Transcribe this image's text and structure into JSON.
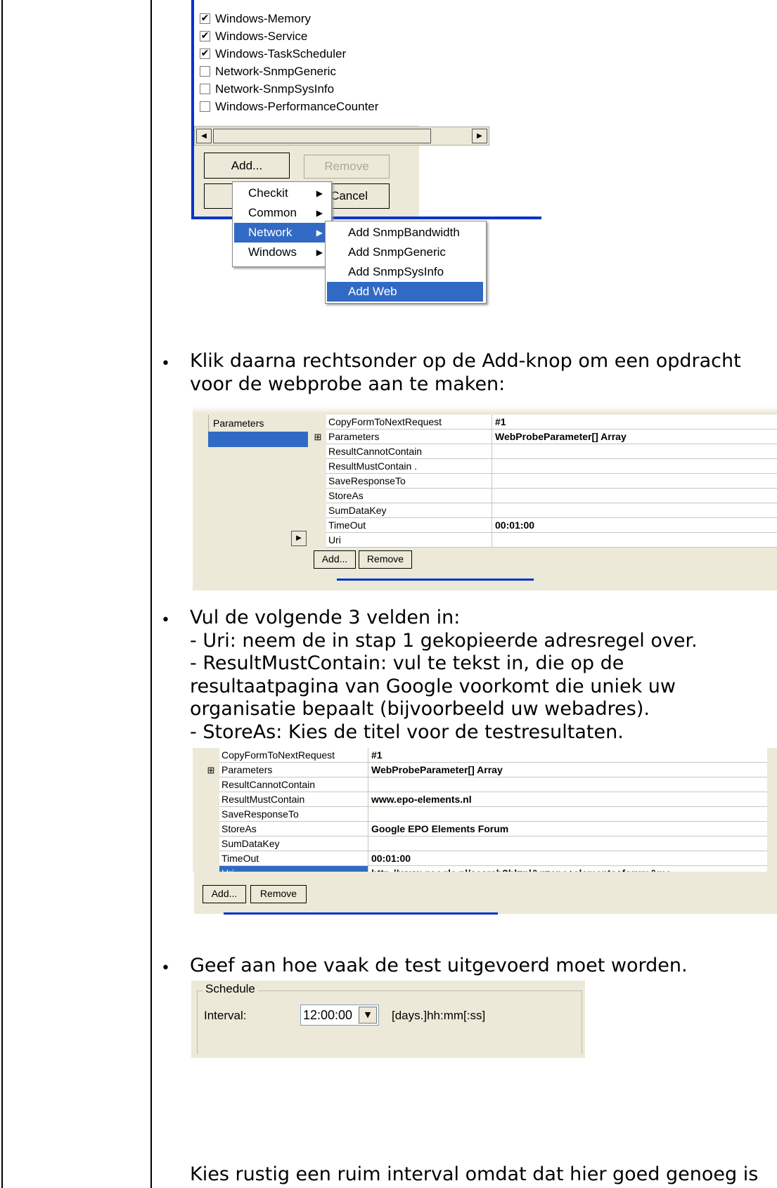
{
  "colors": {
    "selected": "#316ac5",
    "window_bg": "#ece9d8",
    "accent_blue": "#0033cc"
  },
  "checklist": {
    "items": [
      {
        "label": "Windows-Memory",
        "checked": true
      },
      {
        "label": "Windows-Service",
        "checked": true
      },
      {
        "label": "Windows-TaskScheduler",
        "checked": true
      },
      {
        "label": "Network-SnmpGeneric",
        "checked": false
      },
      {
        "label": "Network-SnmpSysInfo",
        "checked": false
      },
      {
        "label": "Windows-PerformanceCounter",
        "checked": false
      }
    ],
    "add_label": "Add...",
    "remove_label": "Remove",
    "cancel_label": "Cancel"
  },
  "context_menu": {
    "items": [
      "Checkit",
      "Common",
      "Network",
      "Windows"
    ],
    "selected": "Network",
    "submenu": [
      "Add SnmpBandwidth",
      "Add SnmpGeneric",
      "Add SnmpSysInfo",
      "Add Web"
    ],
    "submenu_selected": "Add Web"
  },
  "step1": {
    "bullet": "•",
    "line1": "Klik daarna rechtsonder op de Add-knop om een opdracht",
    "line2": "voor de webprobe aan te maken:"
  },
  "grid1": {
    "left_header": "Parameters",
    "rows": [
      {
        "name": "CopyFormToNextRequest",
        "value": "#1"
      },
      {
        "name": "Parameters",
        "value": "WebProbeParameter[] Array",
        "expand": "⊞"
      },
      {
        "name": "ResultCannotContain",
        "value": ""
      },
      {
        "name": "ResultMustContain  .",
        "value": ""
      },
      {
        "name": "SaveResponseTo",
        "value": ""
      },
      {
        "name": "StoreAs",
        "value": ""
      },
      {
        "name": "SumDataKey",
        "value": ""
      },
      {
        "name": "TimeOut",
        "value": "00:01:00"
      },
      {
        "name": "Uri",
        "value": ""
      }
    ],
    "add_label": "Add...",
    "remove_label": "Remove"
  },
  "step2": {
    "bullet": "•",
    "lines": [
      "Vul de volgende 3 velden in:",
      "- Uri: neem de in stap 1 gekopieerde adresregel over.",
      "- ResultMustContain: vul te tekst in, die op de",
      "resultaatpagina van Google voorkomt die uniek uw",
      "organisatie bepaalt (bijvoorbeeld uw webadres).",
      "- StoreAs: Kies de titel voor de testresultaten."
    ]
  },
  "grid2": {
    "rows": [
      {
        "name": "CopyFormToNextRequest",
        "value": "#1"
      },
      {
        "name": "Parameters",
        "value": "WebProbeParameter[] Array",
        "expand": "⊞"
      },
      {
        "name": "ResultCannotContain",
        "value": ""
      },
      {
        "name": "ResultMustContain",
        "value": "www.epo-elements.nl"
      },
      {
        "name": "SaveResponseTo",
        "value": ""
      },
      {
        "name": "StoreAs",
        "value": "Google EPO Elements Forum"
      },
      {
        "name": "SumDataKey",
        "value": ""
      },
      {
        "name": "TimeOut",
        "value": "00:01:00"
      },
      {
        "name": "Uri",
        "value": "http://www.google.nl/search?hl=nl&q=epo+elements+forum&me"
      }
    ],
    "selected_row": "Uri",
    "add_label": "Add...",
    "remove_label": "Remove"
  },
  "step3": {
    "bullet": "•",
    "line": "Geef aan hoe vaak de test uitgevoerd moet worden."
  },
  "schedule": {
    "group_label": "Schedule",
    "interval_label": "Interval:",
    "interval_value": "12:00:00",
    "format_hint": "[days.]hh:mm[:ss]"
  },
  "footer_text": "Kies rustig een ruim interval omdat dat hier goed genoeg is"
}
